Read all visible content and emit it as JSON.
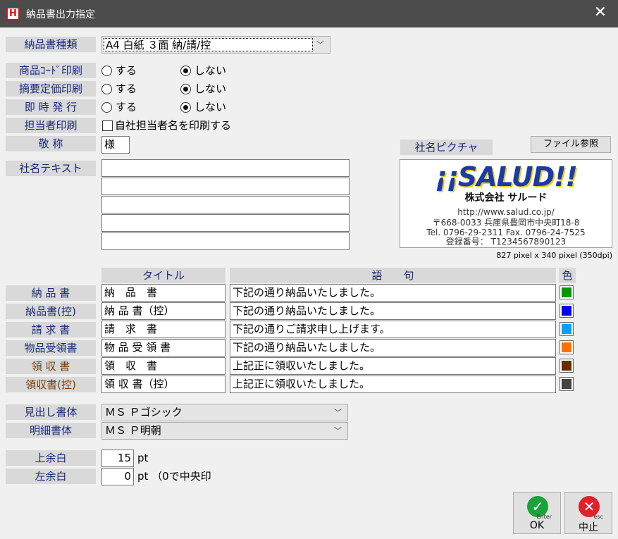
{
  "window": {
    "title": "納品書出力指定",
    "app_icon": "H",
    "close_glyph": "✕"
  },
  "form": {
    "type_label": "納品書種類",
    "type_value": "A4 白紙 ３面 納/請/控",
    "rows": [
      {
        "label": "商品ｺｰﾄﾞ印刷",
        "opt_yes": "する",
        "opt_no": "しない",
        "selected": "no"
      },
      {
        "label": "摘要定価印刷",
        "opt_yes": "する",
        "opt_no": "しない",
        "selected": "no"
      },
      {
        "label": "即 時 発 行",
        "opt_yes": "する",
        "opt_no": "しない",
        "selected": "no"
      }
    ],
    "staff_label": "担当者印刷",
    "staff_check": "自社担当者名を印刷する",
    "honorific_label": "敬 称",
    "honorific_value": "様",
    "company_text_label": "社名テキスト",
    "company_text_lines": [
      "",
      "",
      "",
      "",
      ""
    ]
  },
  "picture": {
    "label": "社名ピクチャ",
    "browse_button": "ファイル参照",
    "logo_text": "¡¡SALUD!!",
    "company_name": "株式会社 サルード",
    "url": "http://www.salud.co.jp/",
    "address": "〒668-0033 兵庫県豊岡市中央町18-8",
    "tel": "Tel. 0796-29-2311 Fax. 0796-24-7525",
    "reg": "登録番号： T1234567890123",
    "size_info": "827 pixel x 340 pixel (350dpi)"
  },
  "table": {
    "col_title": "タイトル",
    "col_phrase": "語　　句",
    "col_color": "色",
    "rows": [
      {
        "label": "納 品 書",
        "title": "納　品　書",
        "phrase": "下記の通り納品いたしました。",
        "color": "#009a00",
        "label_color": "blue"
      },
      {
        "label": "納品書(控)",
        "title": "納 品 書（控）",
        "phrase": "下記の通り納品いたしました。",
        "color": "#0000ee",
        "label_color": "blue"
      },
      {
        "label": "請 求 書",
        "title": "請　求　書",
        "phrase": "下記の通りご請求申し上げます。",
        "color": "#00a2ff",
        "label_color": "blue"
      },
      {
        "label": "物品受領書",
        "title": "物 品 受 領 書",
        "phrase": "下記の通り納品いたしました。",
        "color": "#ff7000",
        "label_color": "blue"
      },
      {
        "label": "領 収 書",
        "title": "領　収　書",
        "phrase": "上記正に領収いたしました。",
        "color": "#6a2a00",
        "label_color": "brown"
      },
      {
        "label": "領収書(控)",
        "title": "領 収 書（控）",
        "phrase": "上記正に領収いたしました。",
        "color": "#444444",
        "label_color": "brown"
      }
    ]
  },
  "fonts": {
    "heading_label": "見出し書体",
    "heading_value": "ＭＳ Ｐゴシック",
    "body_label": "明細書体",
    "body_value": "ＭＳ Ｐ明朝"
  },
  "margins": {
    "top_label": "上余白",
    "top_value": "15",
    "top_unit": "pt",
    "left_label": "左余白",
    "left_value": "0",
    "left_unit": "pt （0で中央印"
  },
  "buttons": {
    "ok_label": "OK",
    "ok_key": "Enter",
    "cancel_label": "中止",
    "cancel_key": "esc"
  }
}
